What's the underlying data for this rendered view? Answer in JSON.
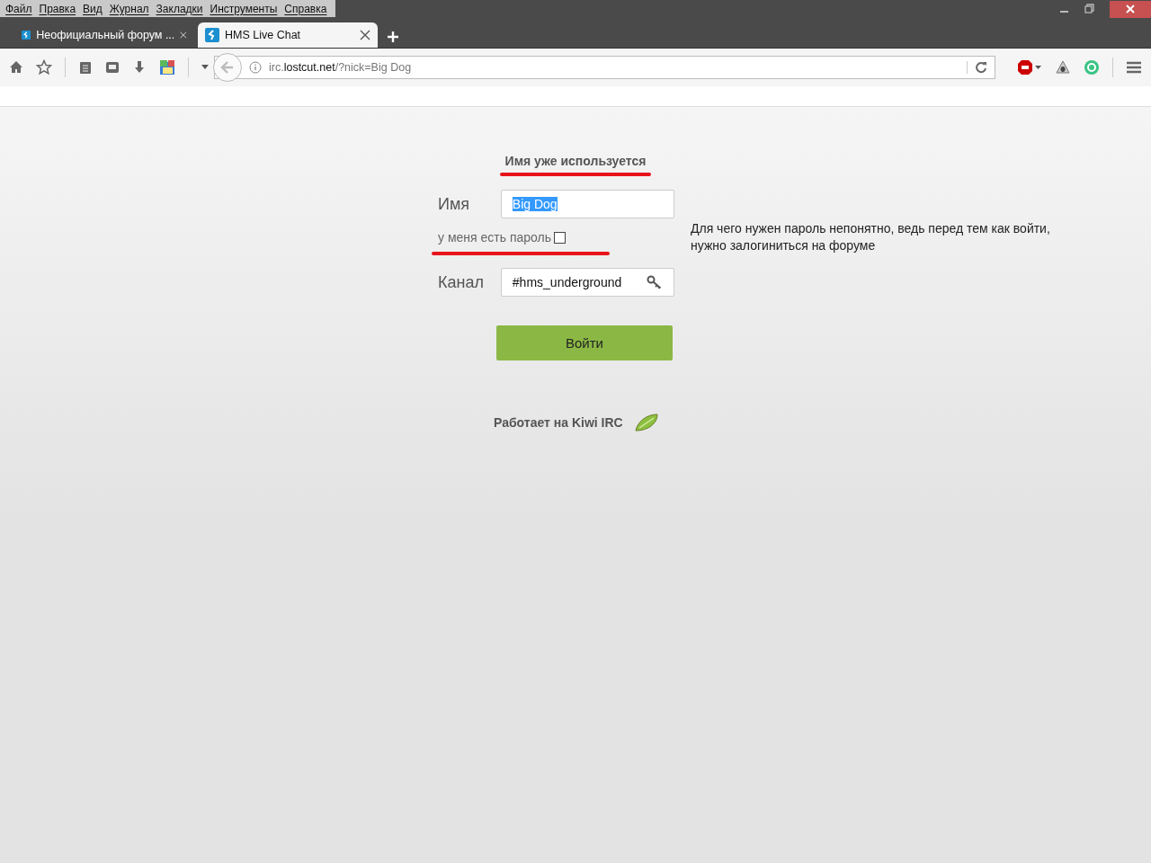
{
  "menu_bar": [
    "Файл",
    "Правка",
    "Вид",
    "Журнал",
    "Закладки",
    "Инструменты",
    "Справка"
  ],
  "tabs": [
    {
      "title": "Неофициальный форум ...",
      "selected": false
    },
    {
      "title": "HMS Live Chat",
      "selected": true
    }
  ],
  "address_bar": {
    "url_prefix": "irc.",
    "url_domain": "lostcut.net",
    "url_path": "/?nick=Big Dog"
  },
  "login_form": {
    "error": "Имя уже используется",
    "name_label": "Имя",
    "name_value": "Big Dog",
    "name_selected": true,
    "password_label": "у меня есть пароль",
    "password_checked": false,
    "channel_label": "Канал",
    "channel_value": "#hms_underground",
    "submit": "Войти",
    "powered_by": "Работает на Kiwi IRC"
  },
  "note": "Для чего нужен пароль непонятно, ведь перед тем как войти, нужно залогиниться на форуме"
}
